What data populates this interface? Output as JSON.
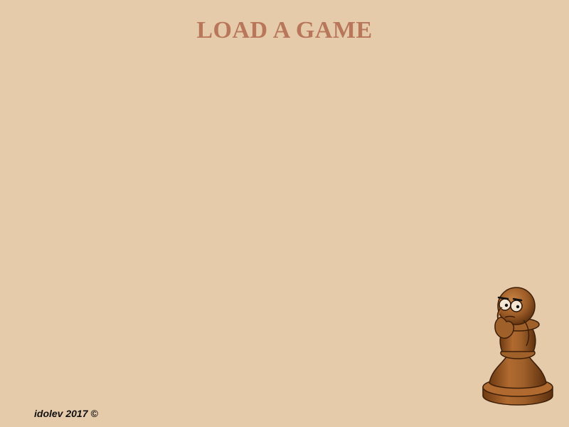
{
  "screen": {
    "title": "LOAD A GAME",
    "copyright": "idolev 2017 ©"
  },
  "mascot": {
    "icon": "thinking-pawn-icon"
  },
  "colors": {
    "background": "#e6cbab",
    "title": "#b8765a",
    "pawn": "#a0602a"
  }
}
